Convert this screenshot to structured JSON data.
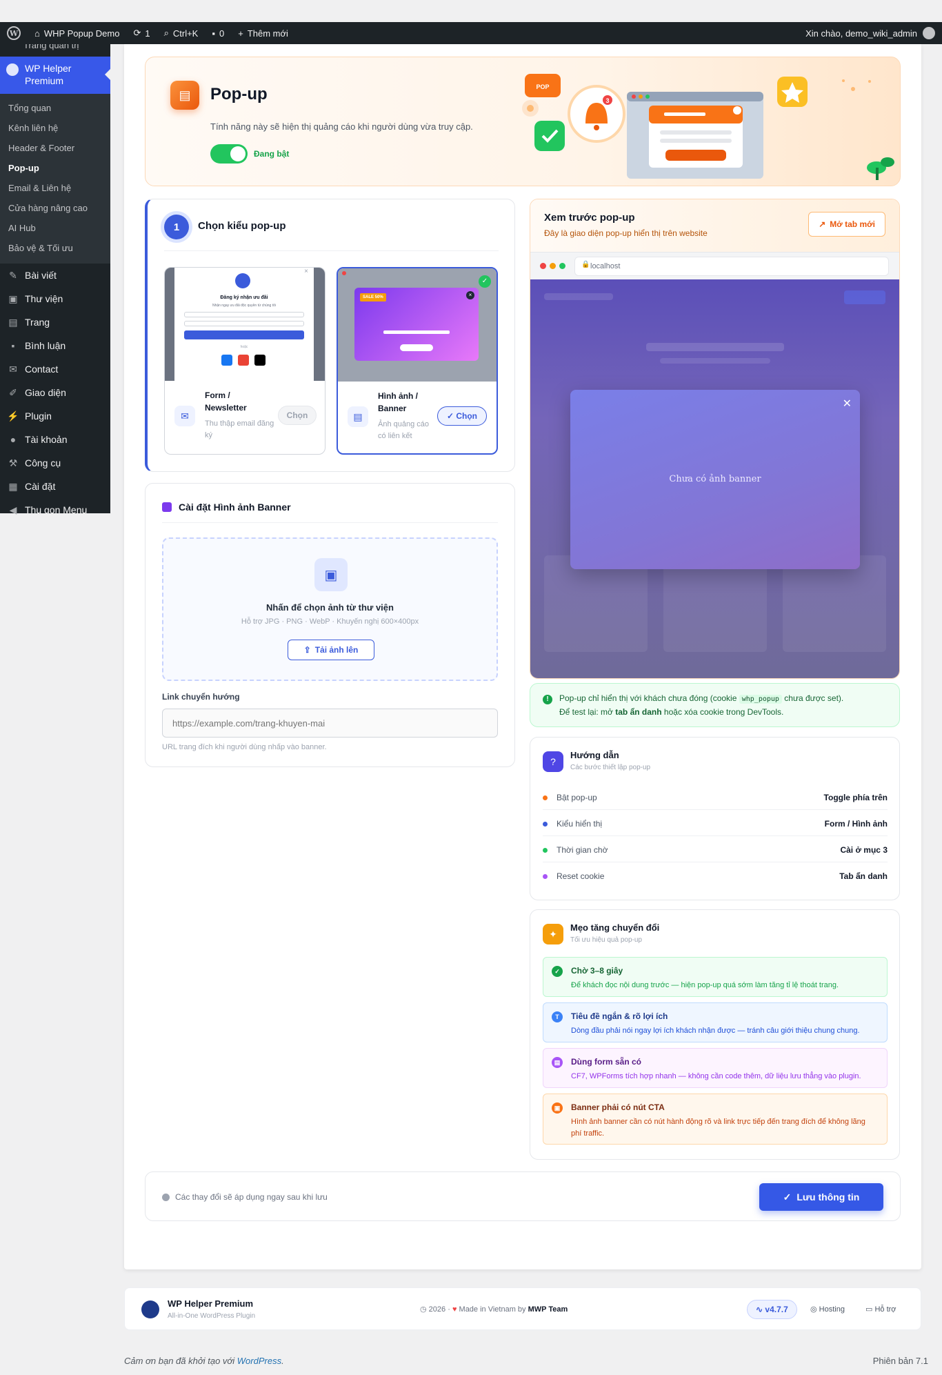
{
  "adminbar": {
    "site_name": "WHP Popup Demo",
    "updates_count": "1",
    "search_shortcut": "Ctrl+K",
    "comments_count": "0",
    "new_label": "Thêm mới",
    "greeting": "Xin chào, demo_wiki_admin"
  },
  "sidebar": {
    "cut_item": "Trang quản trị",
    "active_menu": "WP Helper Premium",
    "submenu": [
      "Tổng quan",
      "Kênh liên hệ",
      "Header & Footer",
      "Pop-up",
      "Email & Liên hệ",
      "Cửa hàng nâng cao",
      "AI Hub",
      "Bảo vệ & Tối ưu"
    ],
    "current_submenu": "Pop-up",
    "menu": [
      {
        "label": "Bài viết",
        "icon": "pin-icon"
      },
      {
        "label": "Thư viện",
        "icon": "media-icon"
      },
      {
        "label": "Trang",
        "icon": "page-icon"
      },
      {
        "label": "Bình luận",
        "icon": "comment-icon"
      },
      {
        "label": "Contact",
        "icon": "mail-icon"
      },
      {
        "label": "Giao diện",
        "icon": "brush-icon"
      },
      {
        "label": "Plugin",
        "icon": "plug-icon"
      },
      {
        "label": "Tài khoản",
        "icon": "user-icon"
      },
      {
        "label": "Công cụ",
        "icon": "wrench-icon"
      },
      {
        "label": "Cài đặt",
        "icon": "settings-icon"
      },
      {
        "label": "Thu gọn Menu",
        "icon": "collapse-icon"
      }
    ]
  },
  "hero": {
    "title": "Pop-up",
    "description": "Tính năng này sẽ hiện thị quảng cáo khi người dùng vừa truy cập.",
    "toggle_label": "Đang bật",
    "toggle_on": true,
    "ill_pop_label": "POP",
    "ill_badge": "3"
  },
  "step": {
    "number": "1",
    "title": "Chọn kiểu pop-up",
    "types": [
      {
        "name": "Form / Newsletter",
        "desc": "Thu thập email đăng ký",
        "button": "Chọn",
        "selected": false,
        "thumb_title": "Đăng ký nhận ưu đãi",
        "thumb_sub": "Nhận ngay ưu đãi độc quyền từ chúng tôi",
        "thumb_or": "hoặc"
      },
      {
        "name": "Hình ảnh / Banner",
        "desc": "Ảnh quảng cáo có liên kết",
        "button": "Chọn",
        "selected": true,
        "thumb_badge": "SALE 50%"
      }
    ]
  },
  "banner_settings": {
    "title": "Cài đặt Hình ảnh Banner",
    "drop_title": "Nhấn để chọn ảnh từ thư viện",
    "drop_sub": "Hỗ trợ JPG · PNG · WebP · Khuyến nghị 600×400px",
    "upload_label": "Tải ảnh lên",
    "link_label": "Link chuyển hướng",
    "link_placeholder": "https://example.com/trang-khuyen-mai",
    "link_hint": "URL trang đích khi người dùng nhấp vào banner."
  },
  "preview": {
    "title": "Xem trước pop-up",
    "subtitle": "Đây là giao diện pop-up hiển thị trên website",
    "open_tab": "Mở tab mới",
    "url": "localhost",
    "empty_banner": "Chưa có ảnh banner"
  },
  "note": {
    "line1_a": "Pop-up chỉ hiển thị với khách chưa đóng (cookie",
    "cookie": "whp_popup",
    "line1_b": "chưa được set).",
    "line2_a": "Để test lại: mở",
    "line2_strong": "tab ẩn danh",
    "line2_b": "hoặc xóa cookie trong DevTools."
  },
  "guide": {
    "title": "Hướng dẫn",
    "subtitle": "Các bước thiết lập pop-up",
    "rows": [
      {
        "key": "Bật pop-up",
        "value": "Toggle phía trên",
        "color": "#f97316"
      },
      {
        "key": "Kiểu hiển thị",
        "value": "Form / Hình ảnh",
        "color": "#3b5bdb"
      },
      {
        "key": "Thời gian chờ",
        "value": "Cài ở mục 3",
        "color": "#22c55e"
      },
      {
        "key": "Reset cookie",
        "value": "Tab ẩn danh",
        "color": "#a855f7"
      }
    ]
  },
  "tips": {
    "title": "Mẹo tăng chuyển đổi",
    "subtitle": "Tối ưu hiệu quả pop-up",
    "items": [
      {
        "title": "Chờ 3–8 giây",
        "desc": "Để khách đọc nội dung trước — hiện pop-up quá sớm làm tăng tỉ lệ thoát trang.",
        "color": "#16a34a",
        "bg": "#f0fdf4",
        "border": "#bbf7d0"
      },
      {
        "title": "Tiêu đề ngắn & rõ lợi ích",
        "desc": "Dòng đầu phải nói ngay lợi ích khách nhận được — tránh câu giới thiệu chung chung.",
        "color": "#1d4ed8",
        "bg": "#eff6ff",
        "border": "#bfdbfe"
      },
      {
        "title": "Dùng form sẵn có",
        "desc": "CF7, WPForms tích hợp nhanh — không cần code thêm, dữ liệu lưu thẳng vào plugin.",
        "color": "#9333ea",
        "bg": "#fdf4ff",
        "border": "#f0d5fb"
      },
      {
        "title": "Banner phải có nút CTA",
        "desc": "Hình ảnh banner cần có nút hành động rõ và link trực tiếp đến trang đích để không lãng phí traffic.",
        "color": "#c2410c",
        "bg": "#fff7ed",
        "border": "#fed7aa"
      }
    ]
  },
  "save": {
    "hint": "Các thay đổi sẽ áp dụng ngay sau khi lưu",
    "button": "Lưu thông tin"
  },
  "footer": {
    "name": "WP Helper Premium",
    "tagline": "All-in-One WordPress Plugin",
    "year": "2026",
    "made_in": "Made in Vietnam by",
    "team": "MWP Team",
    "version": "v4.7.7",
    "hosting": "Hosting",
    "support": "Hỗ trợ"
  },
  "wp_footer": {
    "thanks_prefix": "Cảm ơn bạn đã khởi tạo với",
    "thanks_link": "WordPress",
    "version": "Phiên bản 7.1"
  }
}
